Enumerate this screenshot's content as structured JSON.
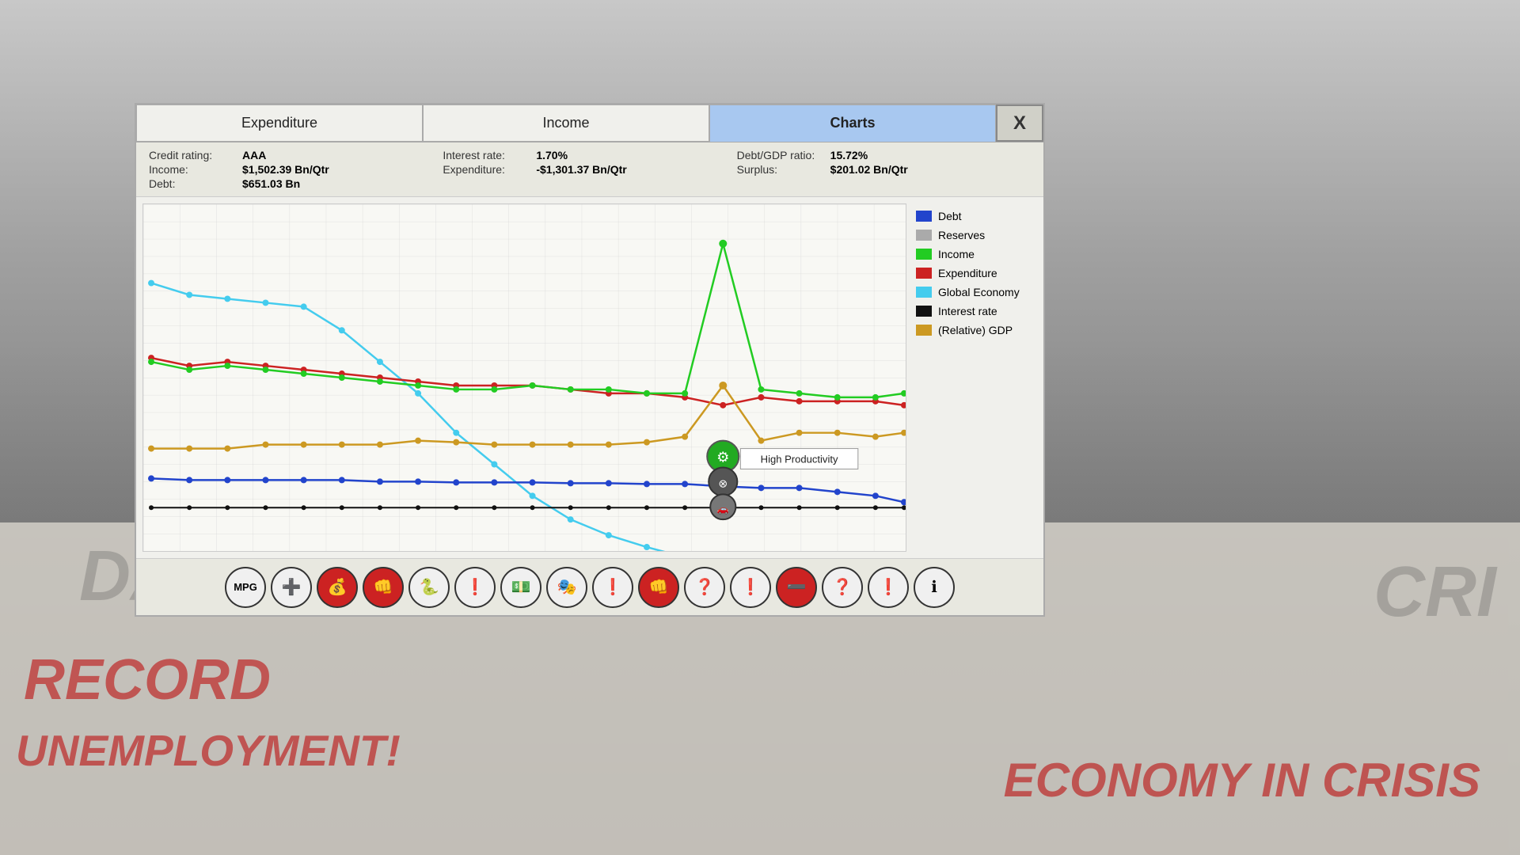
{
  "background": {
    "newspaper_texts": [
      {
        "text": "DA",
        "class": "news-da"
      },
      {
        "text": "RECORD",
        "class": "news-record"
      },
      {
        "text": "UNEMPLOYMENT!",
        "class": "news-unemployment"
      },
      {
        "text": "CRI",
        "class": "news-cri"
      },
      {
        "text": "ECONOMY IN CRISIS",
        "class": "news-economy"
      }
    ]
  },
  "tabs": [
    {
      "label": "Expenditure",
      "active": false
    },
    {
      "label": "Income",
      "active": false
    },
    {
      "label": "Charts",
      "active": true
    }
  ],
  "close_button": "X",
  "stats": {
    "group1": {
      "lines": [
        {
          "label": "Credit rating:",
          "value": "AAA"
        },
        {
          "label": "Income:",
          "value": "$1,502.39 Bn/Qtr"
        },
        {
          "label": "Debt:",
          "value": "$651.03 Bn"
        }
      ]
    },
    "group2": {
      "lines": [
        {
          "label": "Interest rate:",
          "value": "1.70%"
        },
        {
          "label": "Expenditure:",
          "value": "-$1,301.37 Bn/Qtr"
        },
        {
          "label": "",
          "value": ""
        }
      ]
    },
    "group3": {
      "lines": [
        {
          "label": "Debt/GDP ratio:",
          "value": "15.72%"
        },
        {
          "label": "Surplus:",
          "value": "$201.02 Bn/Qtr"
        },
        {
          "label": "",
          "value": ""
        }
      ]
    }
  },
  "legend": [
    {
      "label": "Debt",
      "color": "#2244cc"
    },
    {
      "label": "Reserves",
      "color": "#aaaaaa"
    },
    {
      "label": "Income",
      "color": "#22cc22"
    },
    {
      "label": "Expenditure",
      "color": "#cc2222"
    },
    {
      "label": "Global Economy",
      "color": "#44ccee"
    },
    {
      "label": "Interest rate",
      "color": "#111111"
    },
    {
      "label": "(Relative) GDP",
      "color": "#cc9922"
    }
  ],
  "tooltip": {
    "text": "High Productivity",
    "visible": true
  },
  "events": [
    {
      "symbol": "🚗",
      "type": "normal"
    },
    {
      "symbol": "➕",
      "type": "normal"
    },
    {
      "symbol": "💰",
      "type": "red"
    },
    {
      "symbol": "🤜",
      "type": "red"
    },
    {
      "symbol": "🐍",
      "type": "normal"
    },
    {
      "symbol": "❗",
      "type": "normal"
    },
    {
      "symbol": "💵",
      "type": "normal"
    },
    {
      "symbol": "🎭",
      "type": "normal"
    },
    {
      "symbol": "❗",
      "type": "normal"
    },
    {
      "symbol": "🤜",
      "type": "red"
    },
    {
      "symbol": "❓",
      "type": "normal"
    },
    {
      "symbol": "❗",
      "type": "normal"
    },
    {
      "symbol": "➖",
      "type": "red"
    },
    {
      "symbol": "❓",
      "type": "normal"
    },
    {
      "symbol": "❗",
      "type": "normal"
    },
    {
      "symbol": "ℹ",
      "type": "normal"
    }
  ]
}
